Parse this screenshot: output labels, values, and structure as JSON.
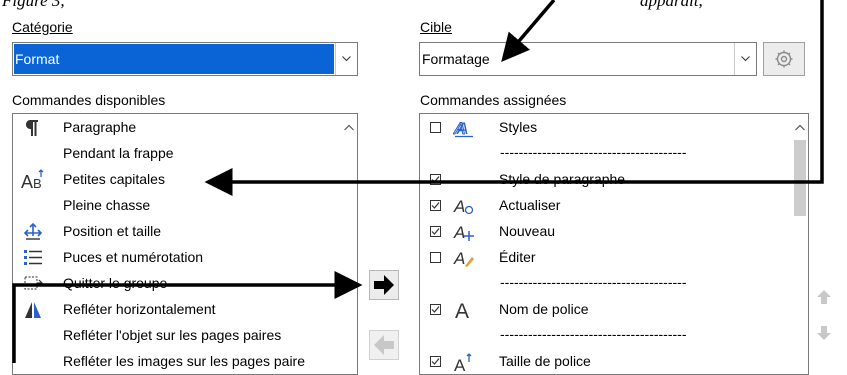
{
  "caption_fragment": {
    "left": "Figure 3,",
    "right": "apparaît,"
  },
  "category": {
    "label": "Catégorie",
    "selected": "Format"
  },
  "target": {
    "label": "Cible",
    "selected": "Formatage"
  },
  "available": {
    "label": "Commandes disponibles",
    "items": [
      {
        "icon": "paragraph-icon",
        "label": "Paragraphe"
      },
      {
        "icon": "",
        "label": "Pendant la frappe"
      },
      {
        "icon": "small-caps-icon",
        "label": "Petites capitales"
      },
      {
        "icon": "",
        "label": "Pleine chasse"
      },
      {
        "icon": "position-size-icon",
        "label": "Position et taille"
      },
      {
        "icon": "bullets-numbering-icon",
        "label": "Puces et numérotation"
      },
      {
        "icon": "exit-group-icon",
        "label": "Quitter le groupe"
      },
      {
        "icon": "flip-horizontal-icon",
        "label": "Refléter horizontalement"
      },
      {
        "icon": "",
        "label": "Refléter l'objet sur les pages paires"
      },
      {
        "icon": "",
        "label": "Refléter les images sur les pages paire"
      }
    ]
  },
  "assigned": {
    "label": "Commandes assignées",
    "separator": "----------------------------------------",
    "items": [
      {
        "checked": false,
        "icon": "styles-icon",
        "label": "Styles"
      },
      {
        "separator": true
      },
      {
        "checked": true,
        "icon": "",
        "label": "Style de paragraphe"
      },
      {
        "checked": true,
        "icon": "update-style-icon",
        "label": "Actualiser"
      },
      {
        "checked": true,
        "icon": "new-style-icon",
        "label": "Nouveau"
      },
      {
        "checked": false,
        "icon": "edit-style-icon",
        "label": "Éditer"
      },
      {
        "separator": true
      },
      {
        "checked": true,
        "icon": "font-name-icon",
        "label": "Nom de police"
      },
      {
        "separator": true
      },
      {
        "checked": true,
        "icon": "font-size-icon",
        "label": "Taille de police"
      }
    ]
  },
  "colors": {
    "selection": "#0a64d6",
    "annotation_arrow": "#000000",
    "disabled_arrow": "#c8c8c8"
  }
}
